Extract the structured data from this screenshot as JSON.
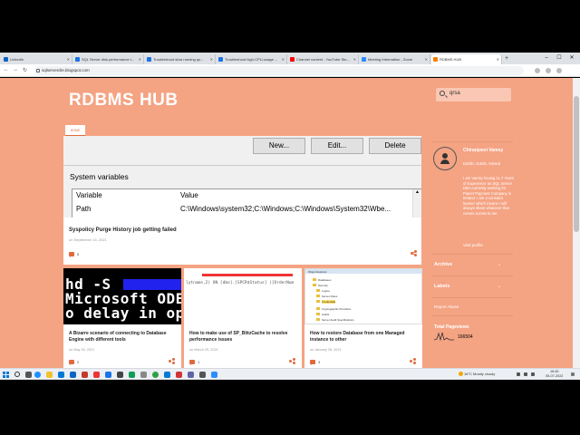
{
  "browser": {
    "tabs": [
      {
        "label": "LinkedIn",
        "color": "#0a66c2"
      },
      {
        "label": "SQL Server disk performance t...",
        "color": "#1a73e8"
      },
      {
        "label": "Troubleshoot slow running qu...",
        "color": "#1a73e8"
      },
      {
        "label": "Troubleshoot high-CPU-usage ...",
        "color": "#1a73e8"
      },
      {
        "label": "Channel content - YouTube Stu...",
        "color": "#ff0000"
      },
      {
        "label": "Meeting Information - Zoom",
        "color": "#2d8cff"
      },
      {
        "label": "RDBMS HUB",
        "color": "#f57d00"
      }
    ],
    "url": "sqlserverdre.blogspot.com"
  },
  "blog": {
    "title": "RDBMS HUB",
    "search_value": "qrsa",
    "home_tab": "HOME"
  },
  "featured": {
    "buttons": [
      "New...",
      "Edit...",
      "Delete"
    ],
    "section_label": "System variables",
    "col_variable": "Variable",
    "col_value": "Value",
    "row_variable": "Path",
    "row_value": "C:\\Windows\\system32;C:\\Windows;C:\\Windows\\System32\\Wbe...",
    "title": "Syspolicy Purge History job getting failed",
    "date": "on September 15, 2021",
    "comments": "5"
  },
  "cards": [
    {
      "title": "A Bizarre scenario of connecting to Database Engine with different tools",
      "date": "on May 30, 2021",
      "comments": "2",
      "thumb_lines": [
        "hd -S ",
        "Microsoft ODE",
        "o delay in op"
      ]
    },
    {
      "title": "How to make use of SP_BlitzCache to resolve performance issues",
      "date": "on March 25, 2021",
      "comments": "1",
      "thumb_line": "lytname,2) ON [dbo].[SPCR$Status] ([OrderNum"
    },
    {
      "title": "How to restore Database from one Managed instance to other",
      "date": "on January 26, 2021",
      "comments": "3",
      "thumb_header": "Object Explorer",
      "thumb_items": [
        "Databases",
        "Security",
        "Logins",
        "Server Roles",
        "Credentials",
        "Cryptographic Providers",
        "Audits",
        "Server Audit Specifications"
      ]
    }
  ],
  "profile": {
    "name": "Chiranjeevi Vamsy",
    "location": "Dublin, Dublin, Ireland",
    "bio": "I am Vamsy having 11.7 Years of Experience as SQL Server DBA currently working for Planet Payment Company in Ireland. I am a constant learner which means I will always share whatever that comes across to me.",
    "visit": "Visit profile"
  },
  "sidebar": {
    "archive": "Archive",
    "labels": "Labels",
    "report_abuse": "Report Abuse",
    "pageviews_label": "Total Pageviews",
    "pageviews_count": "166504"
  },
  "taskbar": {
    "weather": "16°C  Mostly cloudy",
    "time": "16:45",
    "date": "05-07-2022"
  },
  "colors": {
    "page_bg": "#f4a383",
    "accent": "#e06a3c"
  }
}
